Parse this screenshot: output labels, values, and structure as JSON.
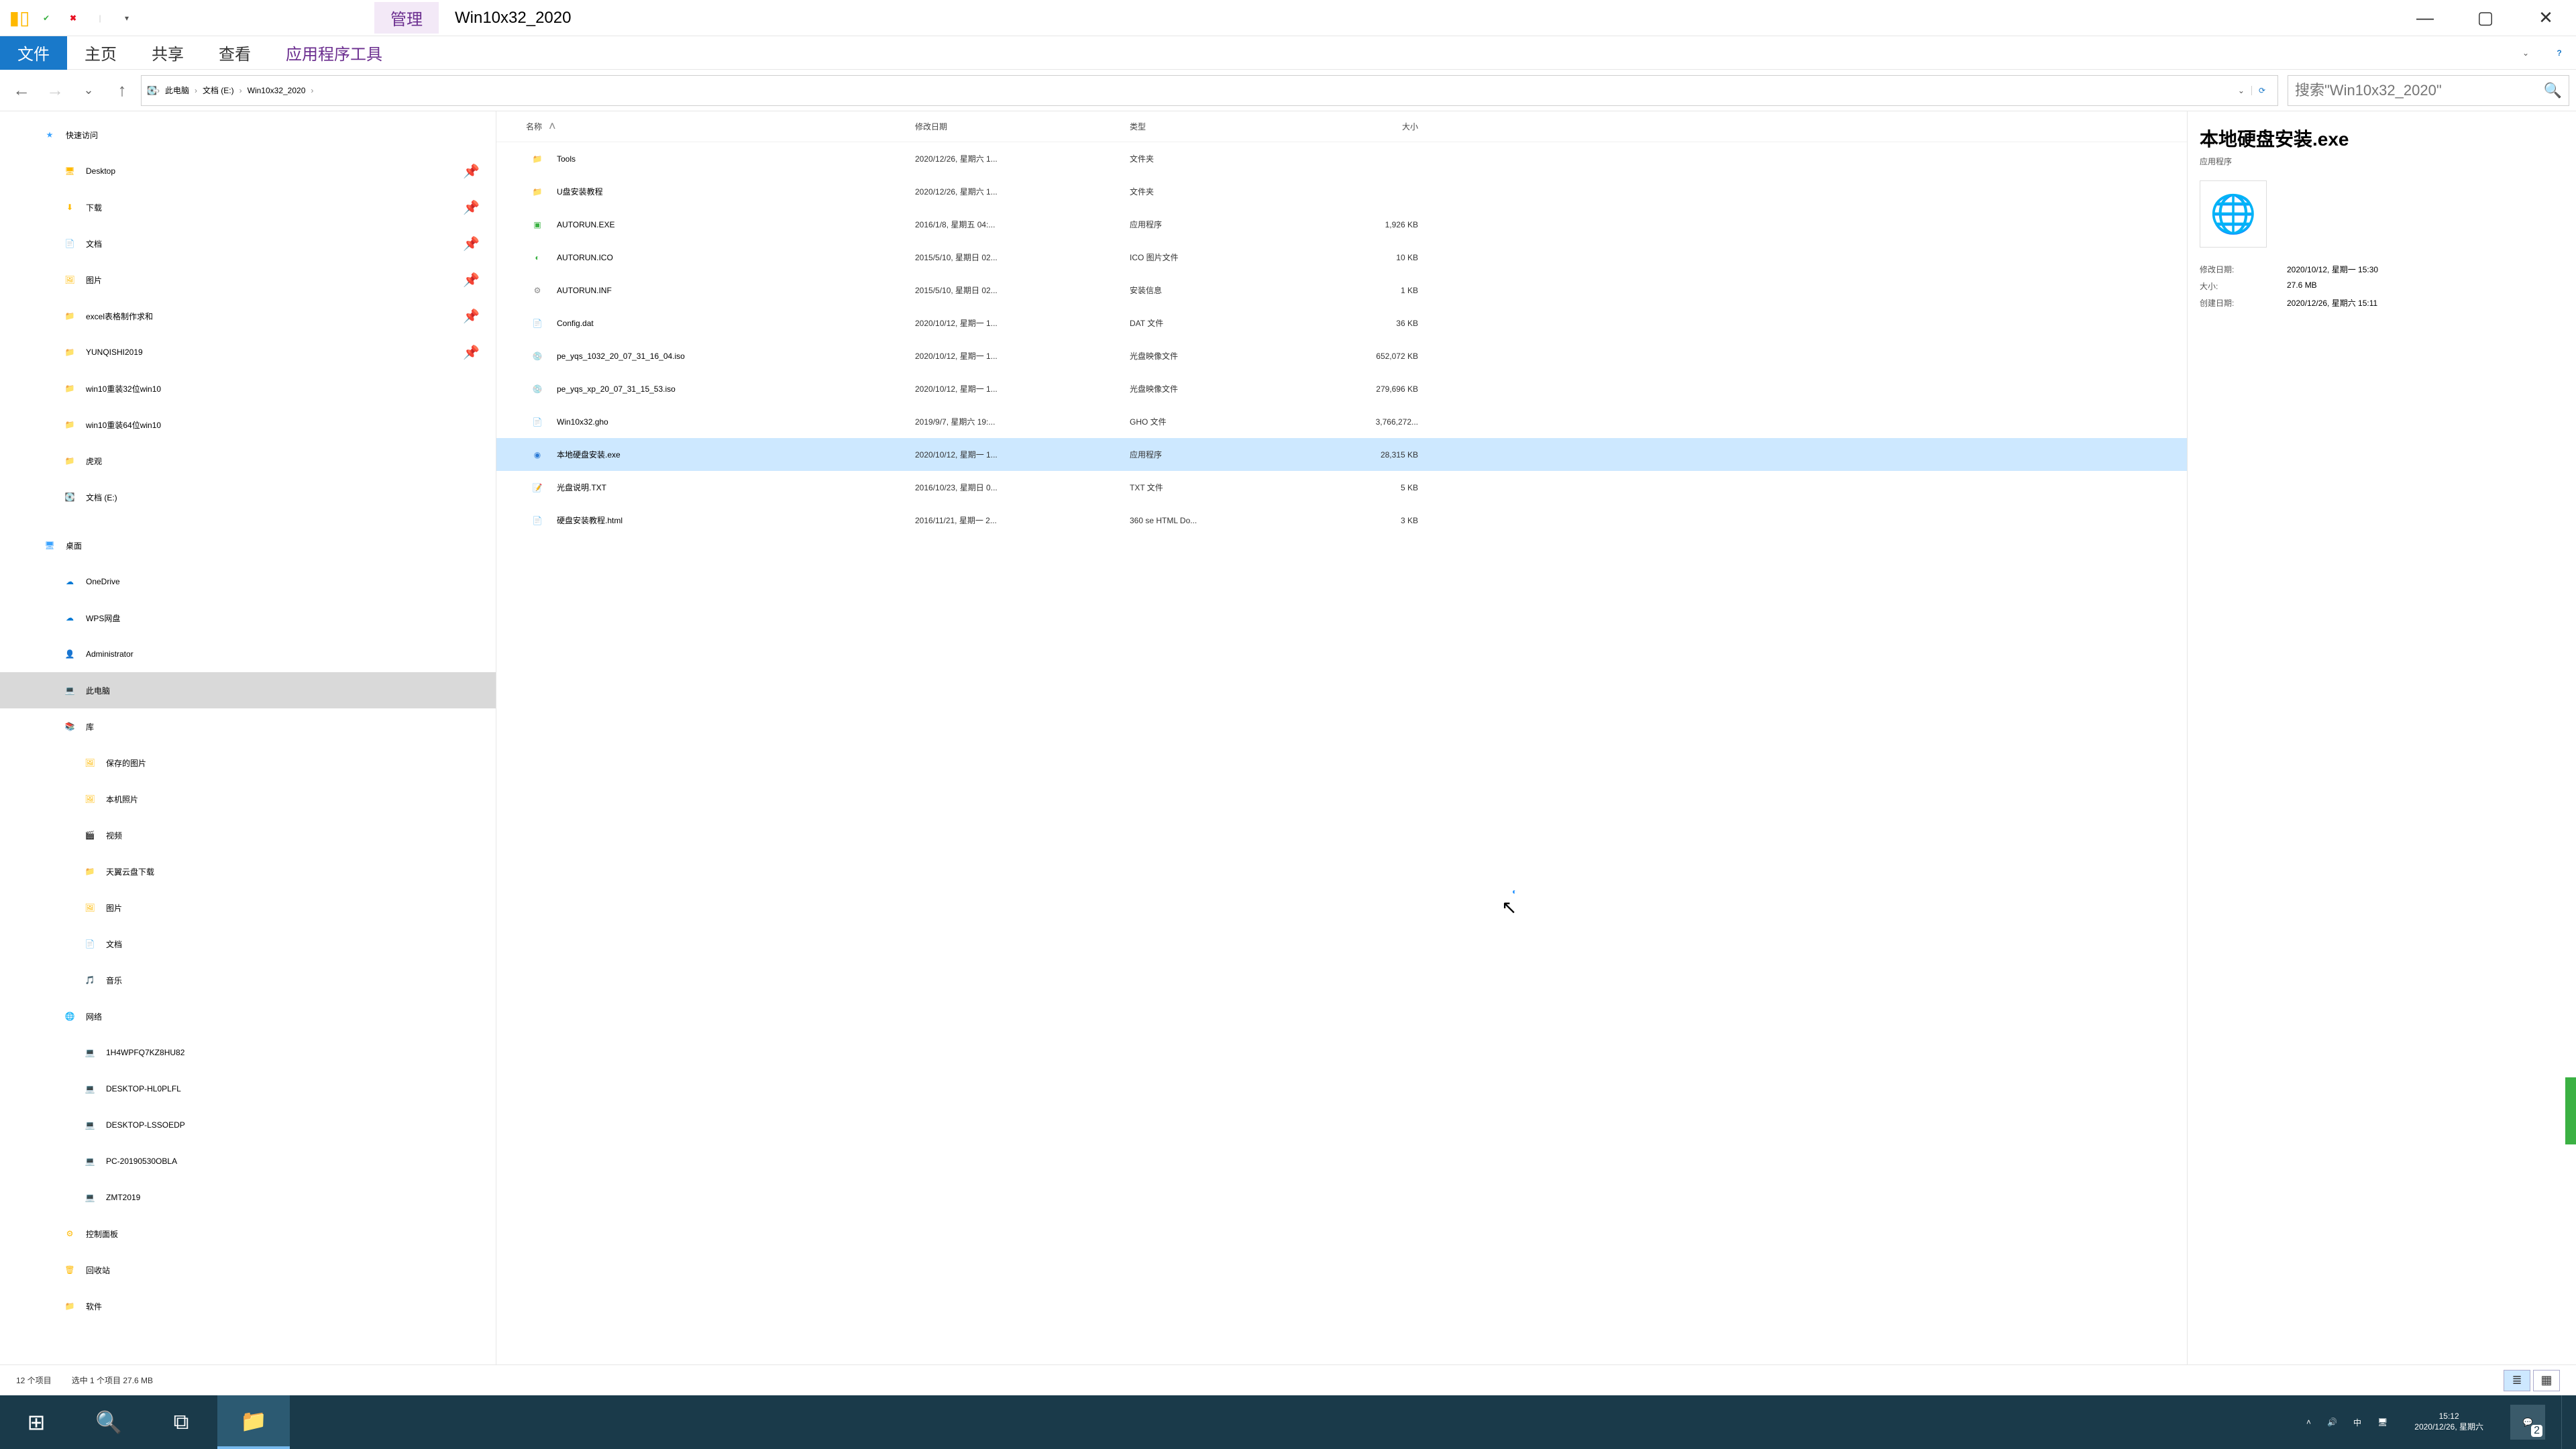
{
  "title": {
    "contextual": "管理",
    "window": "Win10x32_2020"
  },
  "ribbon": {
    "file": "文件",
    "home": "主页",
    "share": "共享",
    "view": "查看",
    "apptools": "应用程序工具"
  },
  "nav": {
    "crumbs": [
      "此电脑",
      "文档 (E:)",
      "Win10x32_2020"
    ],
    "search_placeholder": "搜索\"Win10x32_2020\""
  },
  "tree": {
    "quick": "快速访问",
    "quick_items": [
      {
        "icon": "🖥",
        "label": "Desktop",
        "pin": true
      },
      {
        "icon": "⬇",
        "label": "下载",
        "pin": true
      },
      {
        "icon": "📄",
        "label": "文档",
        "pin": true
      },
      {
        "icon": "🖼",
        "label": "图片",
        "pin": true
      },
      {
        "icon": "📁",
        "label": "excel表格制作求和",
        "pin": true
      },
      {
        "icon": "📁",
        "label": "YUNQISHI2019",
        "pin": true
      },
      {
        "icon": "📁",
        "label": "win10重装32位win10"
      },
      {
        "icon": "📁",
        "label": "win10重装64位win10"
      },
      {
        "icon": "📁",
        "label": "虎观"
      },
      {
        "icon": "💽",
        "label": "文档 (E:)"
      }
    ],
    "desktop": "桌面",
    "desktop_items": [
      {
        "icon": "☁",
        "label": "OneDrive",
        "color": "#0078d4"
      },
      {
        "icon": "☁",
        "label": "WPS网盘",
        "color": "#0078d4"
      },
      {
        "icon": "👤",
        "label": "Administrator"
      },
      {
        "icon": "💻",
        "label": "此电脑",
        "sel": true
      },
      {
        "icon": "📚",
        "label": "库"
      }
    ],
    "lib_items": [
      {
        "icon": "🖼",
        "label": "保存的图片"
      },
      {
        "icon": "🖼",
        "label": "本机照片"
      },
      {
        "icon": "🎬",
        "label": "视频"
      },
      {
        "icon": "📁",
        "label": "天翼云盘下载"
      },
      {
        "icon": "🖼",
        "label": "图片"
      },
      {
        "icon": "📄",
        "label": "文档"
      },
      {
        "icon": "🎵",
        "label": "音乐"
      }
    ],
    "network": "网络",
    "network_items": [
      {
        "icon": "💻",
        "label": "1H4WPFQ7KZ8HU82"
      },
      {
        "icon": "💻",
        "label": "DESKTOP-HL0PLFL"
      },
      {
        "icon": "💻",
        "label": "DESKTOP-LSSOEDP"
      },
      {
        "icon": "💻",
        "label": "PC-20190530OBLA"
      },
      {
        "icon": "💻",
        "label": "ZMT2019"
      }
    ],
    "tail": [
      {
        "icon": "⚙",
        "label": "控制面板"
      },
      {
        "icon": "🗑",
        "label": "回收站"
      },
      {
        "icon": "📁",
        "label": "软件"
      }
    ]
  },
  "cols": {
    "name": "名称",
    "date": "修改日期",
    "type": "类型",
    "size": "大小"
  },
  "rows": [
    {
      "icon": "📁",
      "cls": "ic-folder",
      "name": "Tools",
      "date": "2020/12/26, 星期六 1...",
      "type": "文件夹",
      "size": ""
    },
    {
      "icon": "📁",
      "cls": "ic-folder",
      "name": "U盘安装教程",
      "date": "2020/12/26, 星期六 1...",
      "type": "文件夹",
      "size": ""
    },
    {
      "icon": "▣",
      "cls": "ic-green",
      "name": "AUTORUN.EXE",
      "date": "2016/1/8, 星期五 04:...",
      "type": "应用程序",
      "size": "1,926 KB"
    },
    {
      "icon": "◐",
      "cls": "ic-green",
      "name": "AUTORUN.ICO",
      "date": "2015/5/10, 星期日 02...",
      "type": "ICO 图片文件",
      "size": "10 KB"
    },
    {
      "icon": "⚙",
      "cls": "ic-gray",
      "name": "AUTORUN.INF",
      "date": "2015/5/10, 星期日 02...",
      "type": "安装信息",
      "size": "1 KB"
    },
    {
      "icon": "📄",
      "cls": "ic-gray",
      "name": "Config.dat",
      "date": "2020/10/12, 星期一 1...",
      "type": "DAT 文件",
      "size": "36 KB"
    },
    {
      "icon": "💿",
      "cls": "ic-gray",
      "name": "pe_yqs_1032_20_07_31_16_04.iso",
      "date": "2020/10/12, 星期一 1...",
      "type": "光盘映像文件",
      "size": "652,072 KB"
    },
    {
      "icon": "💿",
      "cls": "ic-gray",
      "name": "pe_yqs_xp_20_07_31_15_53.iso",
      "date": "2020/10/12, 星期一 1...",
      "type": "光盘映像文件",
      "size": "279,696 KB"
    },
    {
      "icon": "📄",
      "cls": "ic-gray",
      "name": "Win10x32.gho",
      "date": "2019/9/7, 星期六 19:...",
      "type": "GHO 文件",
      "size": "3,766,272..."
    },
    {
      "icon": "◉",
      "cls": "ic-blue",
      "name": "本地硬盘安装.exe",
      "date": "2020/10/12, 星期一 1...",
      "type": "应用程序",
      "size": "28,315 KB",
      "sel": true
    },
    {
      "icon": "📝",
      "cls": "ic-green",
      "name": "光盘说明.TXT",
      "date": "2016/10/23, 星期日 0...",
      "type": "TXT 文件",
      "size": "5 KB"
    },
    {
      "icon": "📄",
      "cls": "ic-gray",
      "name": "硬盘安装教程.html",
      "date": "2016/11/21, 星期一 2...",
      "type": "360 se HTML Do...",
      "size": "3 KB"
    }
  ],
  "preview": {
    "name": "本地硬盘安装.exe",
    "type": "应用程序",
    "meta": [
      {
        "k": "修改日期:",
        "v": "2020/10/12, 星期一 15:30"
      },
      {
        "k": "大小:",
        "v": "27.6 MB"
      },
      {
        "k": "创建日期:",
        "v": "2020/12/26, 星期六 15:11"
      }
    ]
  },
  "status": {
    "count": "12 个项目",
    "sel": "选中 1 个项目  27.6 MB"
  },
  "taskbar": {
    "time": "15:12",
    "date": "2020/12/26, 星期六",
    "ime": "中",
    "notif": "2"
  }
}
